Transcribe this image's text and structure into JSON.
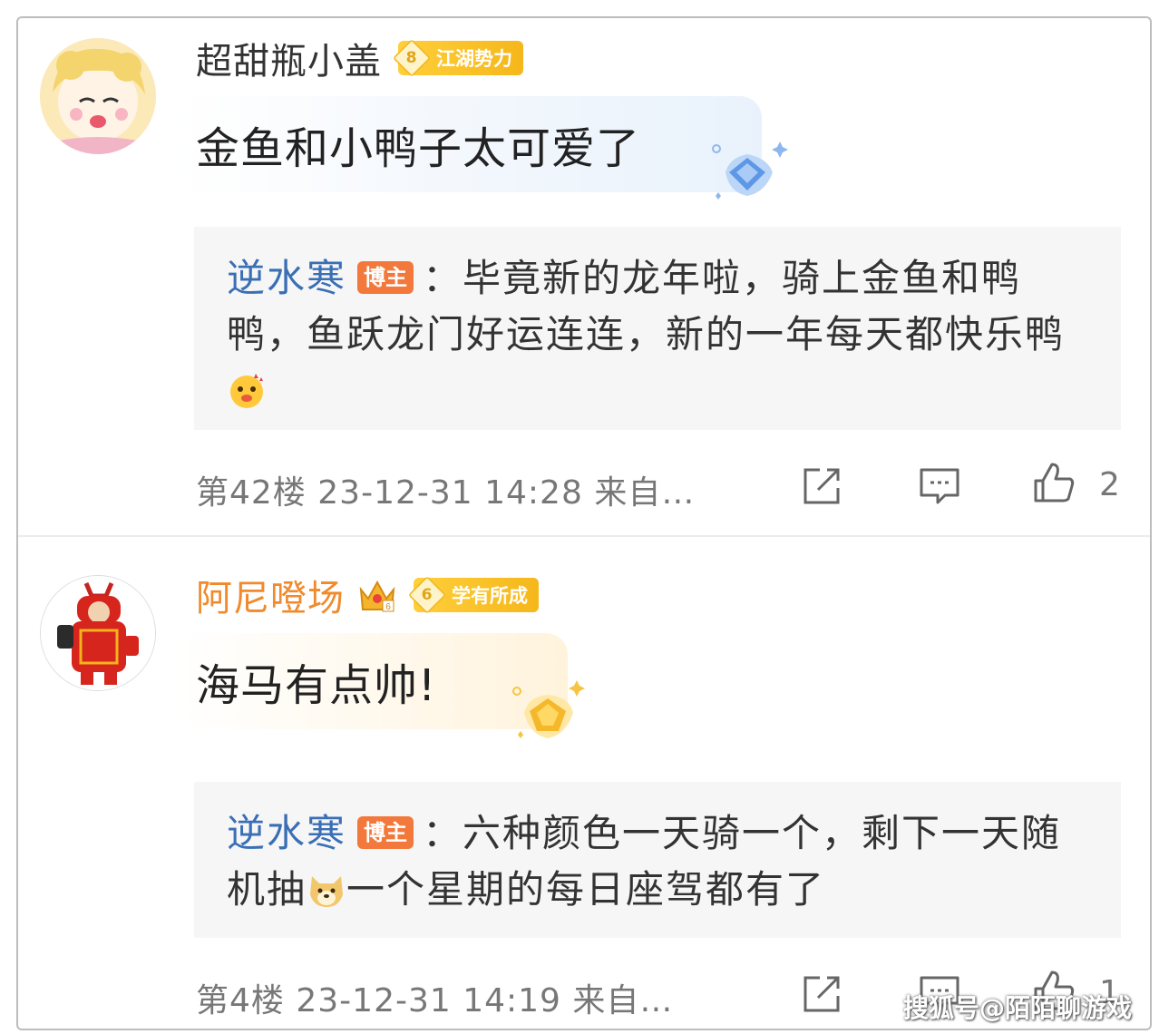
{
  "comments": [
    {
      "username": "超甜瓶小盖",
      "badge_level": "8",
      "badge_label": "江湖势力",
      "text": "金鱼和小鸭子太可爱了",
      "reply": {
        "author": "逆水寒",
        "tag": "博主",
        "colon": "：",
        "text": "毕竟新的龙年啦，骑上金鱼和鸭鸭，鱼跃龙门好运连连，新的一年每天都快乐鸭",
        "text_after_emoji": ""
      },
      "floor": "第42楼",
      "datetime": "23-12-31 14:28",
      "source": "来自…",
      "likes": "2"
    },
    {
      "username": "阿尼噔场",
      "badge_level": "6",
      "badge_label": "学有所成",
      "text": "海马有点帅!",
      "reply": {
        "author": "逆水寒",
        "tag": "博主",
        "colon": "：",
        "text": "六种颜色一天骑一个，剩下一天随机抽",
        "text_after_emoji": "一个星期的每日座驾都有了"
      },
      "floor": "第4楼",
      "datetime": "23-12-31 14:19",
      "source": "来自…",
      "likes": "1"
    }
  ],
  "watermark": "搜狐号@陌陌聊游戏",
  "icons": {
    "share": "share-icon",
    "comment": "comment-icon",
    "like": "thumbs-up-icon"
  },
  "colors": {
    "reply_author": "#3a6fb5",
    "vip_username": "#f08a2c",
    "badge": "#f5b71b",
    "blogger_tag": "#f2793b"
  }
}
